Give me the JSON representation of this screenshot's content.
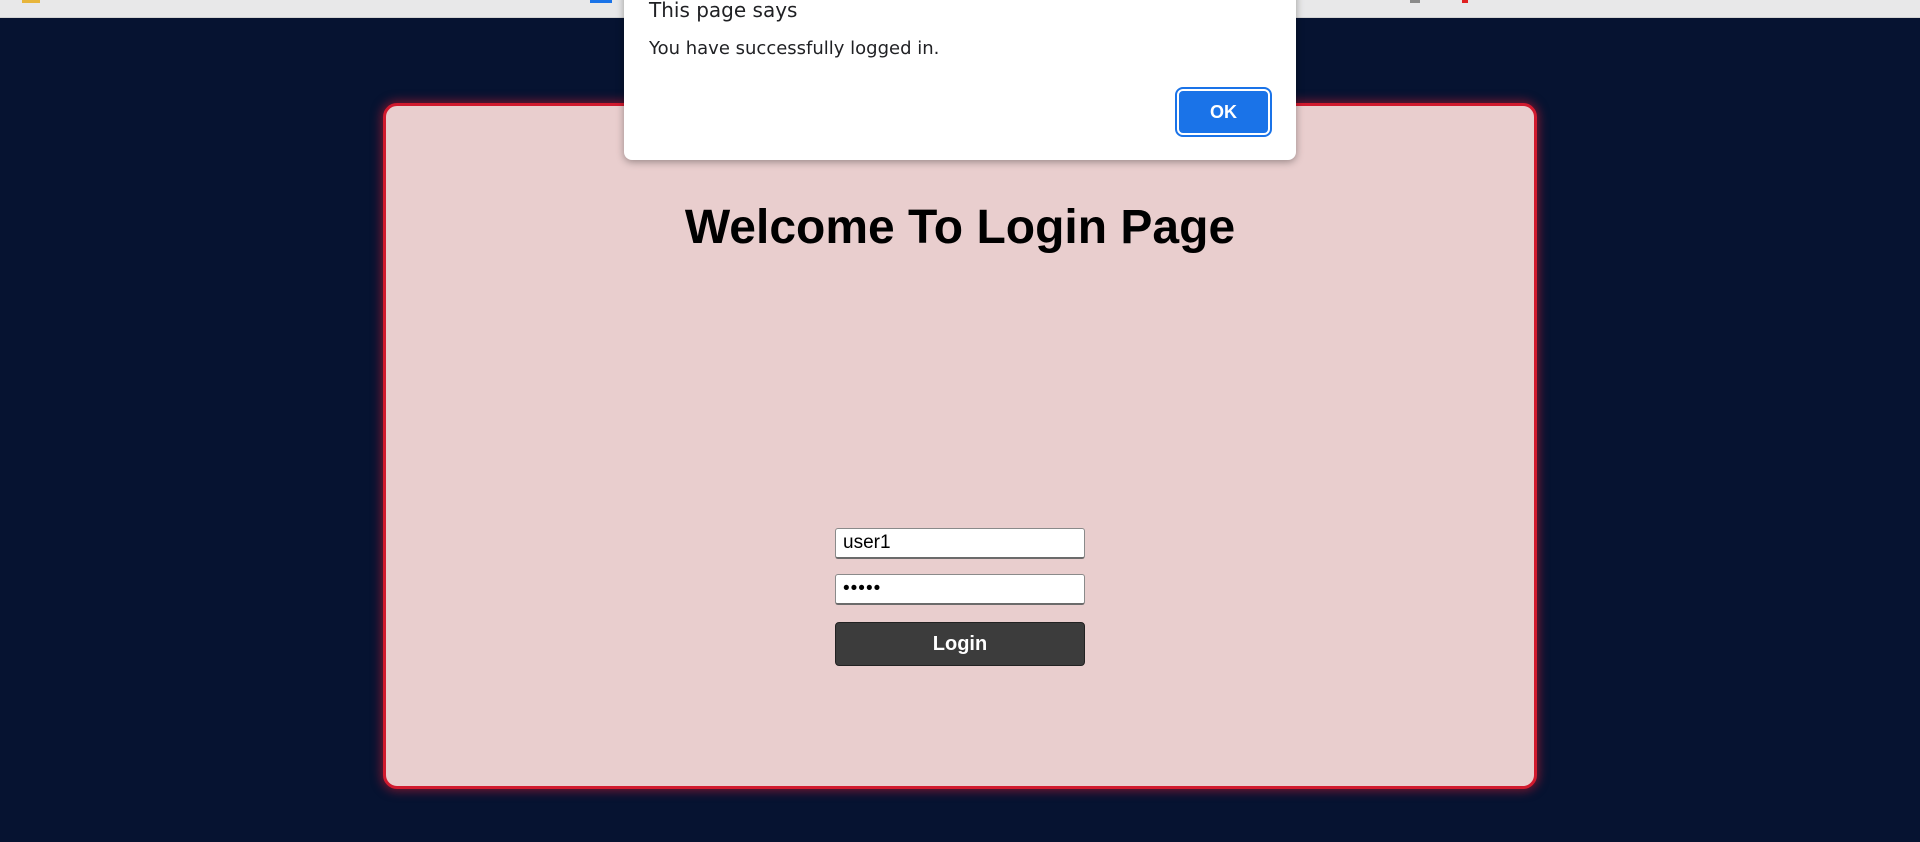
{
  "colors": {
    "page_background": "#061331",
    "card_background": "#e9cece",
    "card_border": "#d11a2e",
    "login_button": "#3c3c3c",
    "ok_button": "#1a73e8"
  },
  "login_card": {
    "title": "Welcome To Login Page",
    "username_value": "user1",
    "password_value": "•••••",
    "login_label": "Login"
  },
  "alert": {
    "title": "This page says",
    "message": "You have successfully logged in.",
    "ok_label": "OK"
  }
}
